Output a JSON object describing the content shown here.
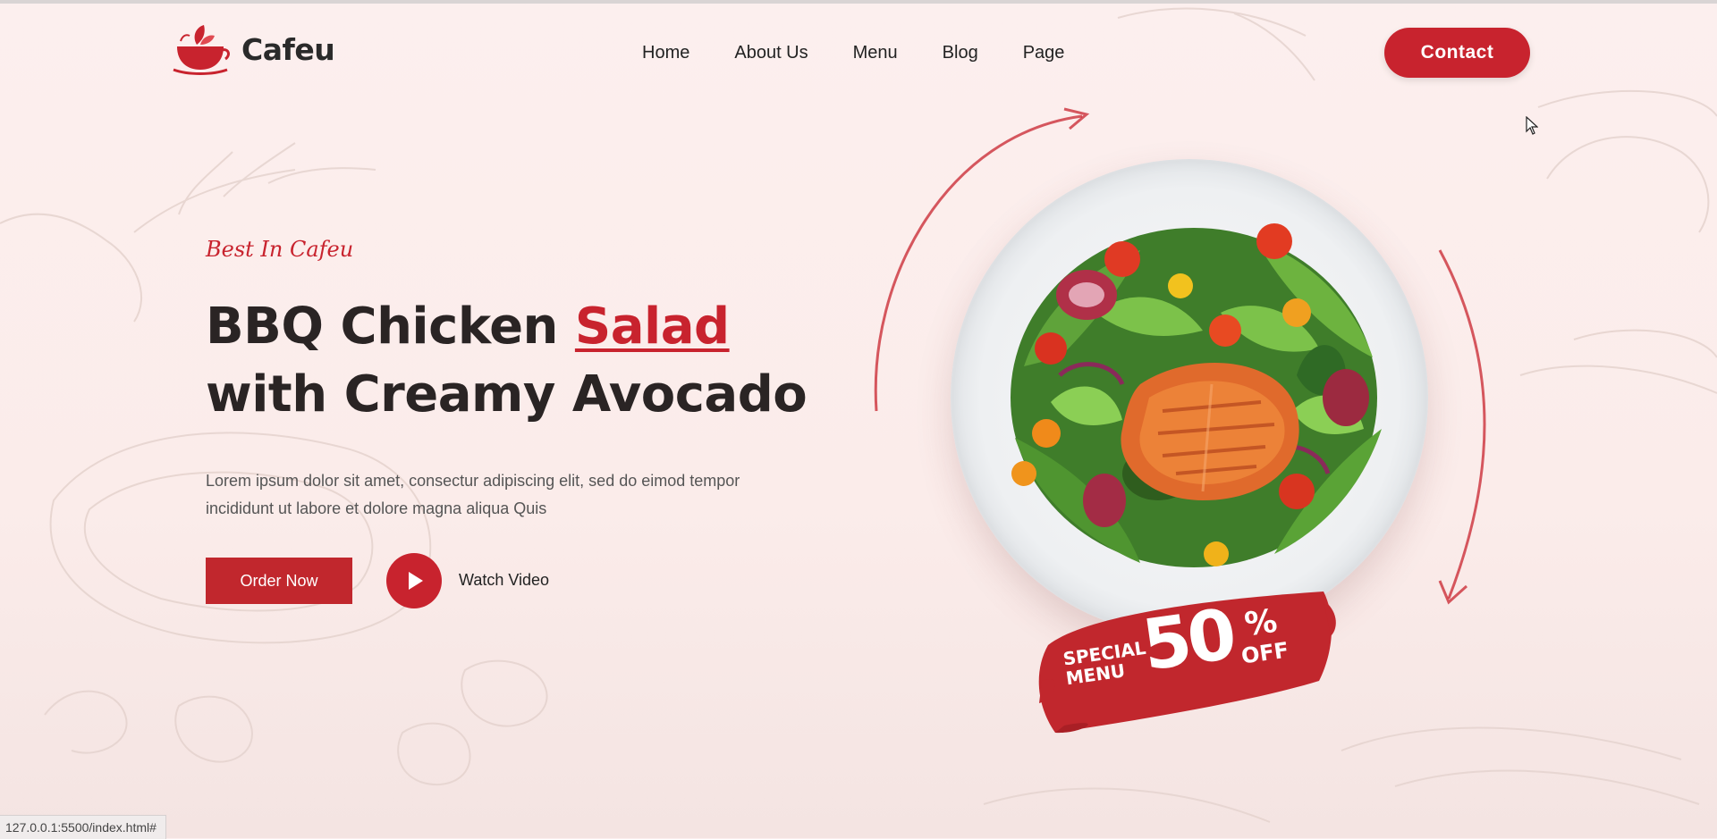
{
  "brand": {
    "name": "Cafeu",
    "logo_icon": "teacup-leaf-icon"
  },
  "nav": {
    "items": [
      {
        "label": "Home"
      },
      {
        "label": "About Us"
      },
      {
        "label": "Menu"
      },
      {
        "label": "Blog"
      },
      {
        "label": "Page"
      }
    ]
  },
  "header": {
    "contact_label": "Contact"
  },
  "hero": {
    "tagline": "Best In Cafeu",
    "headline_part1": "BBQ Chicken ",
    "headline_accent": "Salad",
    "headline_part2": " with Creamy Avocado",
    "description": "Lorem ipsum dolor sit amet, consectur adipiscing elit, sed do eimod tempor incididunt ut labore et dolore magna aliqua Quis",
    "order_label": "Order Now",
    "watch_label": "Watch Video",
    "play_icon": "play-icon"
  },
  "offer": {
    "special_line1": "SPECIAL",
    "special_line2": "MENU",
    "amount": "50",
    "percent": "%",
    "off": "OFF"
  },
  "status_bar": {
    "url": "127.0.0.1:5500/index.html#"
  },
  "colors": {
    "accent": "#c8232e",
    "text_dark": "#2a2424",
    "background": "#fcefee"
  }
}
